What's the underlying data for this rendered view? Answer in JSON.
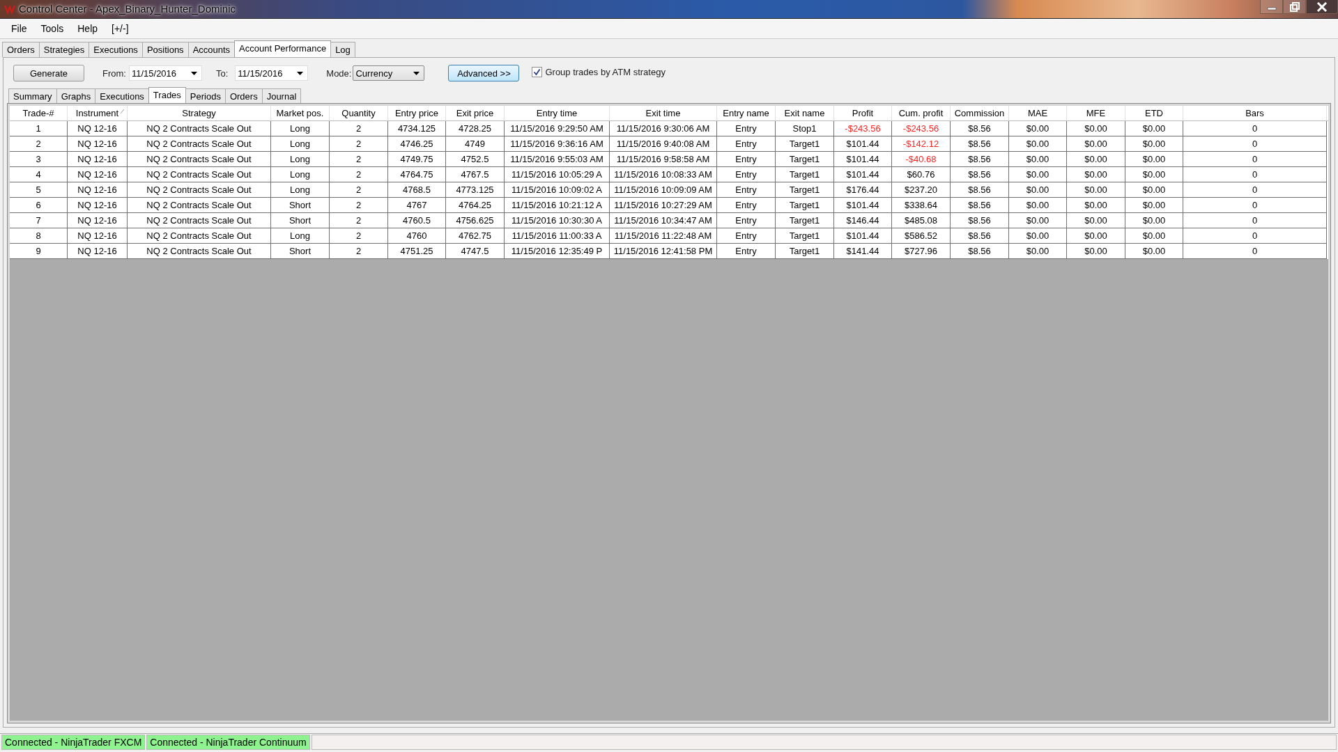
{
  "window": {
    "title": "Control Center - Apex_Binary_Hunter_Dominic"
  },
  "menu": [
    "File",
    "Tools",
    "Help",
    "[+/-]"
  ],
  "tabs": [
    {
      "label": "Orders",
      "selected": false
    },
    {
      "label": "Strategies",
      "selected": false
    },
    {
      "label": "Executions",
      "selected": false
    },
    {
      "label": "Positions",
      "selected": false
    },
    {
      "label": "Accounts",
      "selected": false
    },
    {
      "label": "Account Performance",
      "selected": true
    },
    {
      "label": "Log",
      "selected": false
    }
  ],
  "toolbar": {
    "generate": "Generate",
    "from_label": "From:",
    "from_value": "11/15/2016",
    "to_label": "To:",
    "to_value": "11/15/2016",
    "mode_label": "Mode:",
    "mode_value": "Currency",
    "advanced": "Advanced >>",
    "group_label": "Group trades by ATM strategy",
    "group_checked": true
  },
  "subtabs": [
    {
      "label": "Summary",
      "selected": false
    },
    {
      "label": "Graphs",
      "selected": false
    },
    {
      "label": "Executions",
      "selected": false
    },
    {
      "label": "Trades",
      "selected": true
    },
    {
      "label": "Periods",
      "selected": false
    },
    {
      "label": "Orders",
      "selected": false
    },
    {
      "label": "Journal",
      "selected": false
    }
  ],
  "table": {
    "columns": [
      {
        "label": "Trade-#",
        "sorted": false
      },
      {
        "label": "Instrument",
        "sorted": true
      },
      {
        "label": "Strategy",
        "sorted": false
      },
      {
        "label": "Market pos.",
        "sorted": false
      },
      {
        "label": "Quantity",
        "sorted": false
      },
      {
        "label": "Entry price",
        "sorted": false
      },
      {
        "label": "Exit price",
        "sorted": false
      },
      {
        "label": "Entry time",
        "sorted": false
      },
      {
        "label": "Exit time",
        "sorted": false
      },
      {
        "label": "Entry name",
        "sorted": false
      },
      {
        "label": "Exit name",
        "sorted": false
      },
      {
        "label": "Profit",
        "sorted": false
      },
      {
        "label": "Cum. profit",
        "sorted": false
      },
      {
        "label": "Commission",
        "sorted": false
      },
      {
        "label": "MAE",
        "sorted": false
      },
      {
        "label": "MFE",
        "sorted": false
      },
      {
        "label": "ETD",
        "sorted": false
      },
      {
        "label": "Bars",
        "sorted": false
      }
    ],
    "rows": [
      {
        "cells": [
          "1",
          "NQ 12-16",
          "NQ 2 Contracts Scale Out",
          "Long",
          "2",
          "4734.125",
          "4728.25",
          "11/15/2016 9:29:50 AM",
          "11/15/2016 9:30:06 AM",
          "Entry",
          "Stop1",
          "-$243.56",
          "-$243.56",
          "$8.56",
          "$0.00",
          "$0.00",
          "$0.00",
          "0"
        ],
        "profit_negative": true,
        "cum_negative": true
      },
      {
        "cells": [
          "2",
          "NQ 12-16",
          "NQ 2 Contracts Scale Out",
          "Long",
          "2",
          "4746.25",
          "4749",
          "11/15/2016 9:36:16 AM",
          "11/15/2016 9:40:08 AM",
          "Entry",
          "Target1",
          "$101.44",
          "-$142.12",
          "$8.56",
          "$0.00",
          "$0.00",
          "$0.00",
          "0"
        ],
        "profit_negative": false,
        "cum_negative": true
      },
      {
        "cells": [
          "3",
          "NQ 12-16",
          "NQ 2 Contracts Scale Out",
          "Long",
          "2",
          "4749.75",
          "4752.5",
          "11/15/2016 9:55:03 AM",
          "11/15/2016 9:58:58 AM",
          "Entry",
          "Target1",
          "$101.44",
          "-$40.68",
          "$8.56",
          "$0.00",
          "$0.00",
          "$0.00",
          "0"
        ],
        "profit_negative": false,
        "cum_negative": true
      },
      {
        "cells": [
          "4",
          "NQ 12-16",
          "NQ 2 Contracts Scale Out",
          "Long",
          "2",
          "4764.75",
          "4767.5",
          "11/15/2016 10:05:29 A",
          "11/15/2016 10:08:33 AM",
          "Entry",
          "Target1",
          "$101.44",
          "$60.76",
          "$8.56",
          "$0.00",
          "$0.00",
          "$0.00",
          "0"
        ],
        "profit_negative": false,
        "cum_negative": false
      },
      {
        "cells": [
          "5",
          "NQ 12-16",
          "NQ 2 Contracts Scale Out",
          "Long",
          "2",
          "4768.5",
          "4773.125",
          "11/15/2016 10:09:02 A",
          "11/15/2016 10:09:09 AM",
          "Entry",
          "Target1",
          "$176.44",
          "$237.20",
          "$8.56",
          "$0.00",
          "$0.00",
          "$0.00",
          "0"
        ],
        "profit_negative": false,
        "cum_negative": false
      },
      {
        "cells": [
          "6",
          "NQ 12-16",
          "NQ 2 Contracts Scale Out",
          "Short",
          "2",
          "4767",
          "4764.25",
          "11/15/2016 10:21:12 A",
          "11/15/2016 10:27:29 AM",
          "Entry",
          "Target1",
          "$101.44",
          "$338.64",
          "$8.56",
          "$0.00",
          "$0.00",
          "$0.00",
          "0"
        ],
        "profit_negative": false,
        "cum_negative": false
      },
      {
        "cells": [
          "7",
          "NQ 12-16",
          "NQ 2 Contracts Scale Out",
          "Short",
          "2",
          "4760.5",
          "4756.625",
          "11/15/2016 10:30:30 A",
          "11/15/2016 10:34:47 AM",
          "Entry",
          "Target1",
          "$146.44",
          "$485.08",
          "$8.56",
          "$0.00",
          "$0.00",
          "$0.00",
          "0"
        ],
        "profit_negative": false,
        "cum_negative": false
      },
      {
        "cells": [
          "8",
          "NQ 12-16",
          "NQ 2 Contracts Scale Out",
          "Long",
          "2",
          "4760",
          "4762.75",
          "11/15/2016 11:00:33 A",
          "11/15/2016 11:22:48 AM",
          "Entry",
          "Target1",
          "$101.44",
          "$586.52",
          "$8.56",
          "$0.00",
          "$0.00",
          "$0.00",
          "0"
        ],
        "profit_negative": false,
        "cum_negative": false
      },
      {
        "cells": [
          "9",
          "NQ 12-16",
          "NQ 2 Contracts Scale Out",
          "Short",
          "2",
          "4751.25",
          "4747.5",
          "11/15/2016 12:35:49 P",
          "11/15/2016 12:41:58 PM",
          "Entry",
          "Target1",
          "$141.44",
          "$727.96",
          "$8.56",
          "$0.00",
          "$0.00",
          "$0.00",
          "0"
        ],
        "profit_negative": false,
        "cum_negative": false
      }
    ]
  },
  "status_bar": [
    "Connected - NinjaTrader FXCM",
    "Connected - NinjaTrader Continuum"
  ]
}
